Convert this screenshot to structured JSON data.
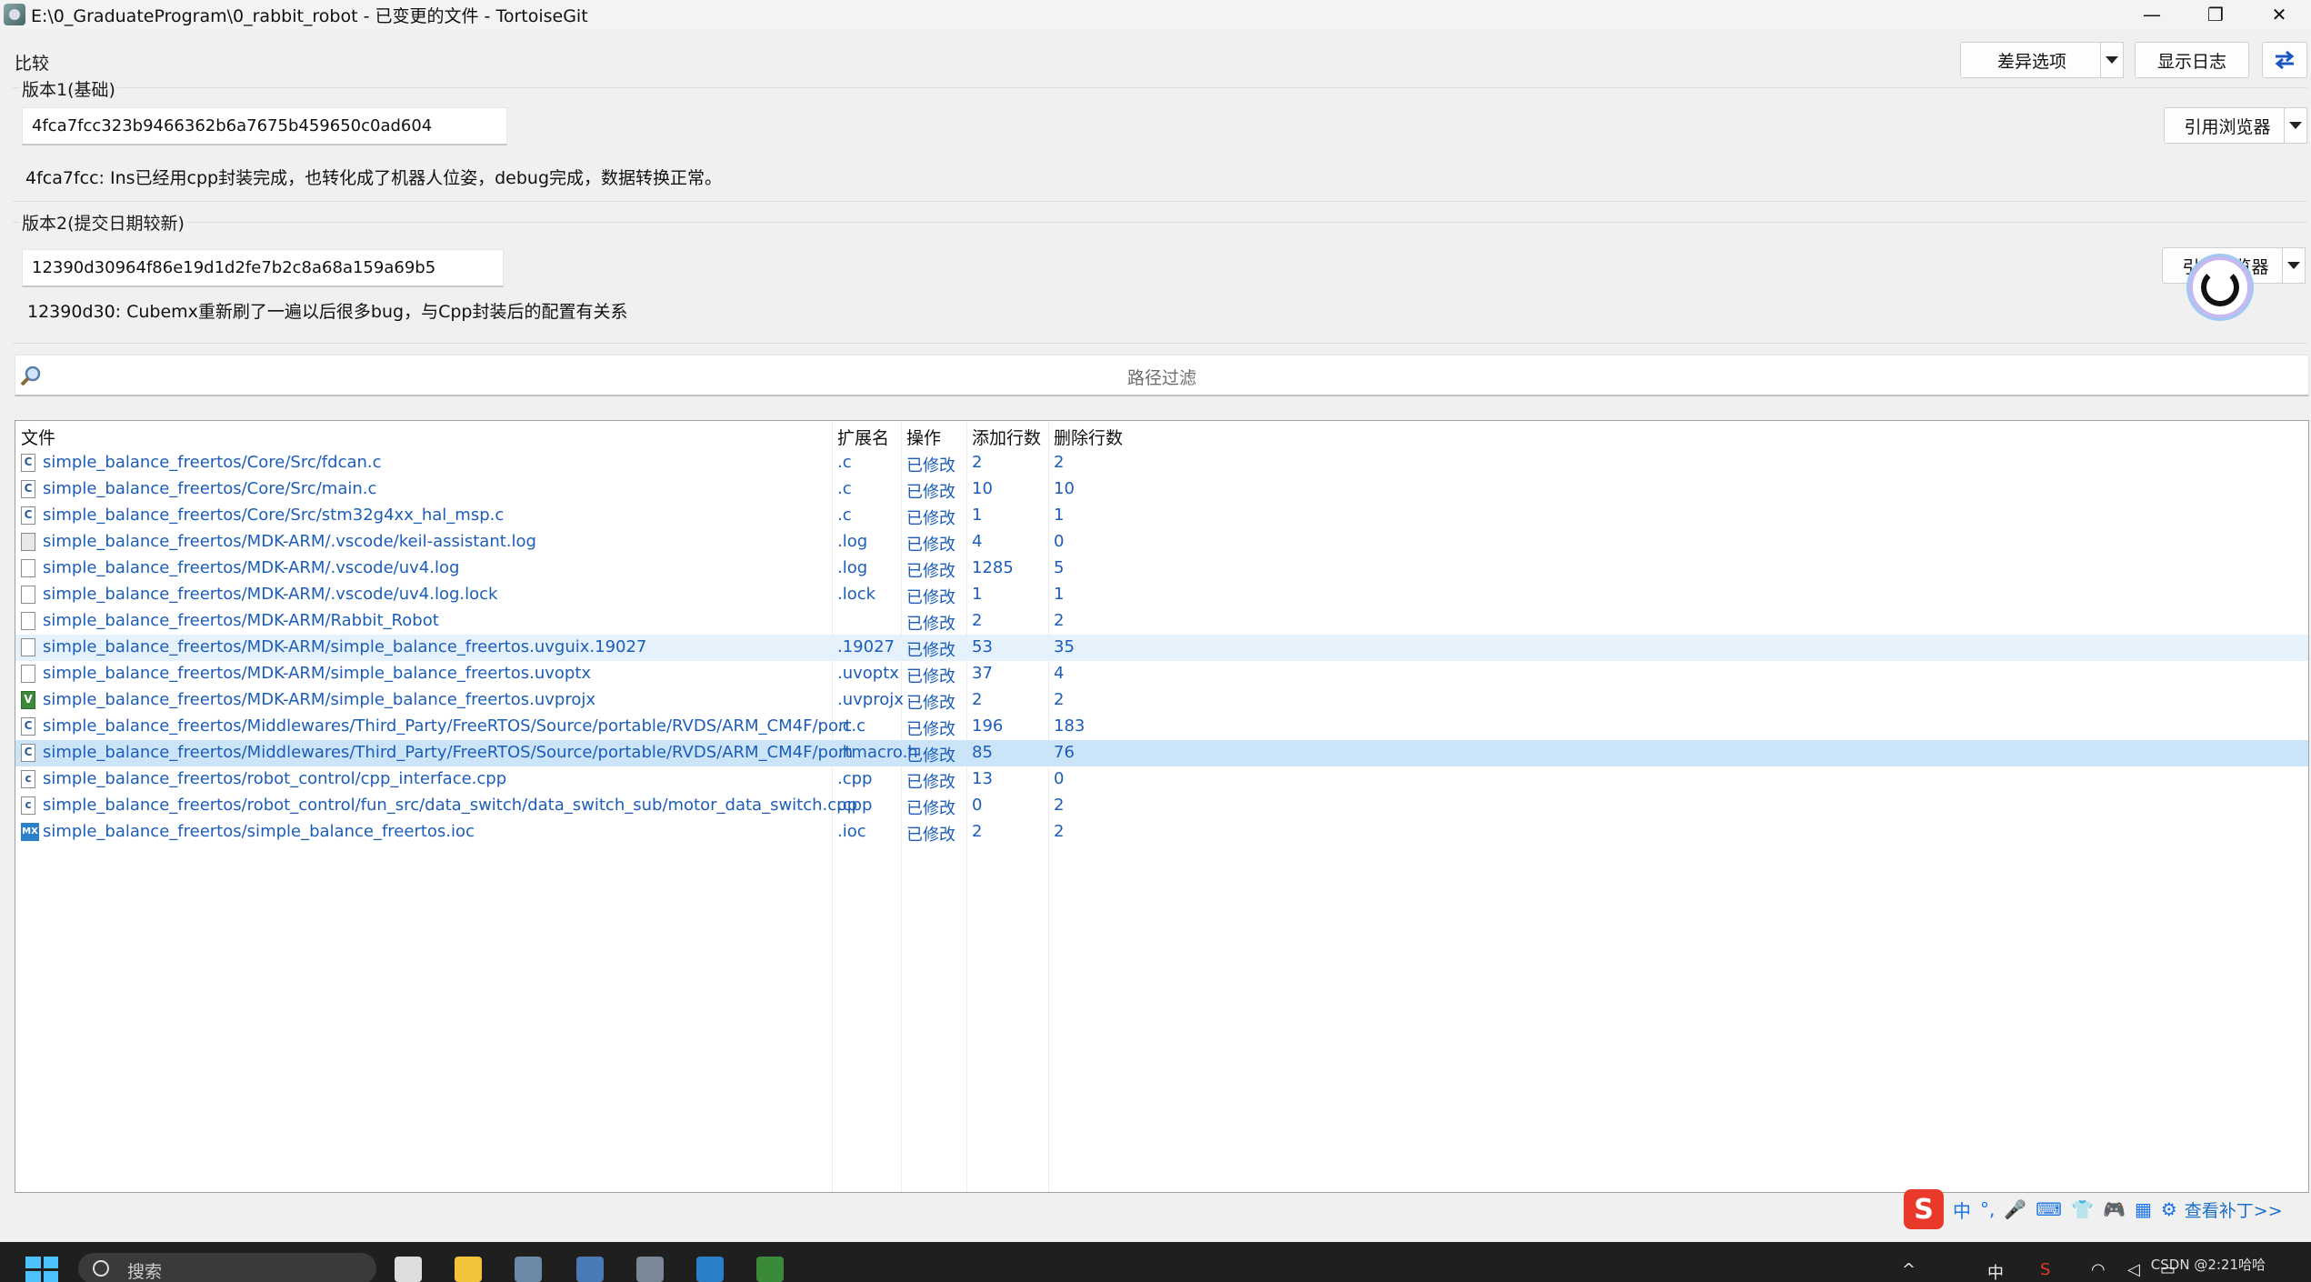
{
  "window": {
    "title": "E:\\0_GraduateProgram\\0_rabbit_robot - 已变更的文件 - TortoiseGit",
    "controls": [
      "—",
      "❐",
      "✕"
    ]
  },
  "toolbar": {
    "compare_label": "比较",
    "diff_options_label": "差异选项",
    "show_log_label": "显示日志",
    "swap_icon": "swap-arrows-icon"
  },
  "version1": {
    "group_title": "版本1(基础)",
    "hash": "4fca7fcc323b9466362b6a7675b459650c0ad604",
    "message": "4fca7fcc: Ins已经用cpp封装完成，也转化成了机器人位姿，debug完成，数据转换正常。",
    "ref_browser_label": "引用浏览器"
  },
  "version2": {
    "group_title": "版本2(提交日期较新)",
    "hash": "12390d30964f86e19d1d2fe7b2c8a68a159a69b5",
    "message": "12390d30: Cubemx重新刷了一遍以后很多bug，与Cpp封装后的配置有关系",
    "ref_browser_label": "引用浏览器"
  },
  "filter": {
    "placeholder": "路径过滤"
  },
  "file_list": {
    "columns": [
      "文件",
      "扩展名",
      "操作",
      "添加行数",
      "删除行数"
    ],
    "rows": [
      {
        "file": "simple_balance_freertos/Core/Src/fdcan.c",
        "ext": ".c",
        "action": "已修改",
        "added": "2",
        "deleted": "2",
        "icon": "c"
      },
      {
        "file": "simple_balance_freertos/Core/Src/main.c",
        "ext": ".c",
        "action": "已修改",
        "added": "10",
        "deleted": "10",
        "icon": "c"
      },
      {
        "file": "simple_balance_freertos/Core/Src/stm32g4xx_hal_msp.c",
        "ext": ".c",
        "action": "已修改",
        "added": "1",
        "deleted": "1",
        "icon": "c"
      },
      {
        "file": "simple_balance_freertos/MDK-ARM/.vscode/keil-assistant.log",
        "ext": ".log",
        "action": "已修改",
        "added": "4",
        "deleted": "0",
        "icon": "log"
      },
      {
        "file": "simple_balance_freertos/MDK-ARM/.vscode/uv4.log",
        "ext": ".log",
        "action": "已修改",
        "added": "1285",
        "deleted": "5",
        "icon": "file"
      },
      {
        "file": "simple_balance_freertos/MDK-ARM/.vscode/uv4.log.lock",
        "ext": ".lock",
        "action": "已修改",
        "added": "1",
        "deleted": "1",
        "icon": "file"
      },
      {
        "file": "simple_balance_freertos/MDK-ARM/Rabbit_Robot",
        "ext": "",
        "action": "已修改",
        "added": "2",
        "deleted": "2",
        "icon": "file"
      },
      {
        "file": "simple_balance_freertos/MDK-ARM/simple_balance_freertos.uvguix.19027",
        "ext": ".19027",
        "action": "已修改",
        "added": "53",
        "deleted": "35",
        "icon": "file"
      },
      {
        "file": "simple_balance_freertos/MDK-ARM/simple_balance_freertos.uvoptx",
        "ext": ".uvoptx",
        "action": "已修改",
        "added": "37",
        "deleted": "4",
        "icon": "file"
      },
      {
        "file": "simple_balance_freertos/MDK-ARM/simple_balance_freertos.uvprojx",
        "ext": ".uvprojx",
        "action": "已修改",
        "added": "2",
        "deleted": "2",
        "icon": "vs"
      },
      {
        "file": "simple_balance_freertos/Middlewares/Third_Party/FreeRTOS/Source/portable/RVDS/ARM_CM4F/port.c",
        "ext": ".c",
        "action": "已修改",
        "added": "196",
        "deleted": "183",
        "icon": "c"
      },
      {
        "file": "simple_balance_freertos/Middlewares/Third_Party/FreeRTOS/Source/portable/RVDS/ARM_CM4F/portmacro.h",
        "ext": ".h",
        "action": "已修改",
        "added": "85",
        "deleted": "76",
        "icon": "c"
      },
      {
        "file": "simple_balance_freertos/robot_control/cpp_interface.cpp",
        "ext": ".cpp",
        "action": "已修改",
        "added": "13",
        "deleted": "0",
        "icon": "cpp"
      },
      {
        "file": "simple_balance_freertos/robot_control/fun_src/data_switch/data_switch_sub/motor_data_switch.cpp",
        "ext": ".cpp",
        "action": "已修改",
        "added": "0",
        "deleted": "2",
        "icon": "cpp"
      },
      {
        "file": "simple_balance_freertos/simple_balance_freertos.ioc",
        "ext": ".ioc",
        "action": "已修改",
        "added": "2",
        "deleted": "2",
        "icon": "mx"
      }
    ]
  },
  "ime": {
    "logo": "S",
    "items": [
      "中",
      "°,",
      "🎤",
      "⌨",
      "👕",
      "🎮",
      "▦",
      "⚙"
    ],
    "patch_link": "查看补丁>>"
  },
  "taskbar": {
    "search_placeholder": "搜索",
    "tray_lang": "中",
    "clock_text": "CSDN @2:21哈哈"
  },
  "colors": {
    "link_blue": "#1c5db8",
    "selected_row": "#cce4f7",
    "hover_row": "#e5f1fb"
  }
}
